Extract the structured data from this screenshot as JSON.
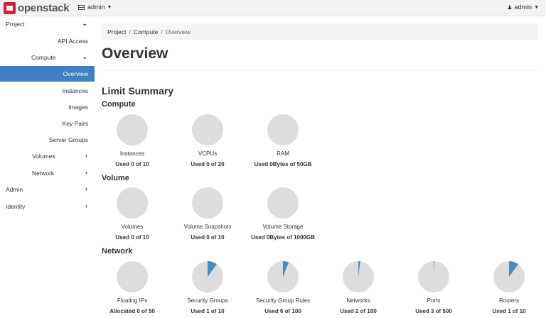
{
  "header": {
    "logo_text": "openstack",
    "logo_tm": ".",
    "project": "admin",
    "user": "admin"
  },
  "breadcrumb": [
    "Project",
    "Compute",
    "Overview"
  ],
  "sidebar": {
    "items": [
      {
        "label": "Project"
      },
      {
        "label": "API Access"
      },
      {
        "label": "Compute"
      },
      {
        "label": "Overview"
      },
      {
        "label": "Instances"
      },
      {
        "label": "Images"
      },
      {
        "label": "Key Pairs"
      },
      {
        "label": "Server Groups"
      },
      {
        "label": "Volumes"
      },
      {
        "label": "Network"
      },
      {
        "label": "Admin"
      },
      {
        "label": "Identity"
      }
    ]
  },
  "page": {
    "title": "Overview",
    "limit_summary": "Limit Summary"
  },
  "sections": [
    {
      "title": "Compute",
      "charts": [
        {
          "label": "Instances",
          "usage": "Used 0 of 10",
          "used": 0,
          "total": 10
        },
        {
          "label": "VCPUs",
          "usage": "Used 0 of 20",
          "used": 0,
          "total": 20
        },
        {
          "label": "RAM",
          "usage": "Used 0Bytes of 50GB",
          "used": 0,
          "total": 50
        }
      ]
    },
    {
      "title": "Volume",
      "charts": [
        {
          "label": "Volumes",
          "usage": "Used 0 of 10",
          "used": 0,
          "total": 10
        },
        {
          "label": "Volume Snapshots",
          "usage": "Used 0 of 10",
          "used": 0,
          "total": 10
        },
        {
          "label": "Volume Storage",
          "usage": "Used 0Bytes of 1000GB",
          "used": 0,
          "total": 1000
        }
      ]
    },
    {
      "title": "Network",
      "charts": [
        {
          "label": "Floating IPs",
          "usage": "Allocated 0 of 50",
          "used": 0,
          "total": 50
        },
        {
          "label": "Security Groups",
          "usage": "Used 1 of 10",
          "used": 1,
          "total": 10
        },
        {
          "label": "Security Group Rules",
          "usage": "Used 6 of 100",
          "used": 6,
          "total": 100
        },
        {
          "label": "Networks",
          "usage": "Used 2 of 100",
          "used": 2,
          "total": 100
        },
        {
          "label": "Ports",
          "usage": "Used 3 of 500",
          "used": 3,
          "total": 500
        },
        {
          "label": "Routers",
          "usage": "Used 1 of 10",
          "used": 1,
          "total": 10
        }
      ]
    }
  ],
  "colors": {
    "accent": "#3f80c4",
    "pie_empty": "#dddddd",
    "pie_used": "#4a89c8",
    "brand": "#da1a32"
  }
}
